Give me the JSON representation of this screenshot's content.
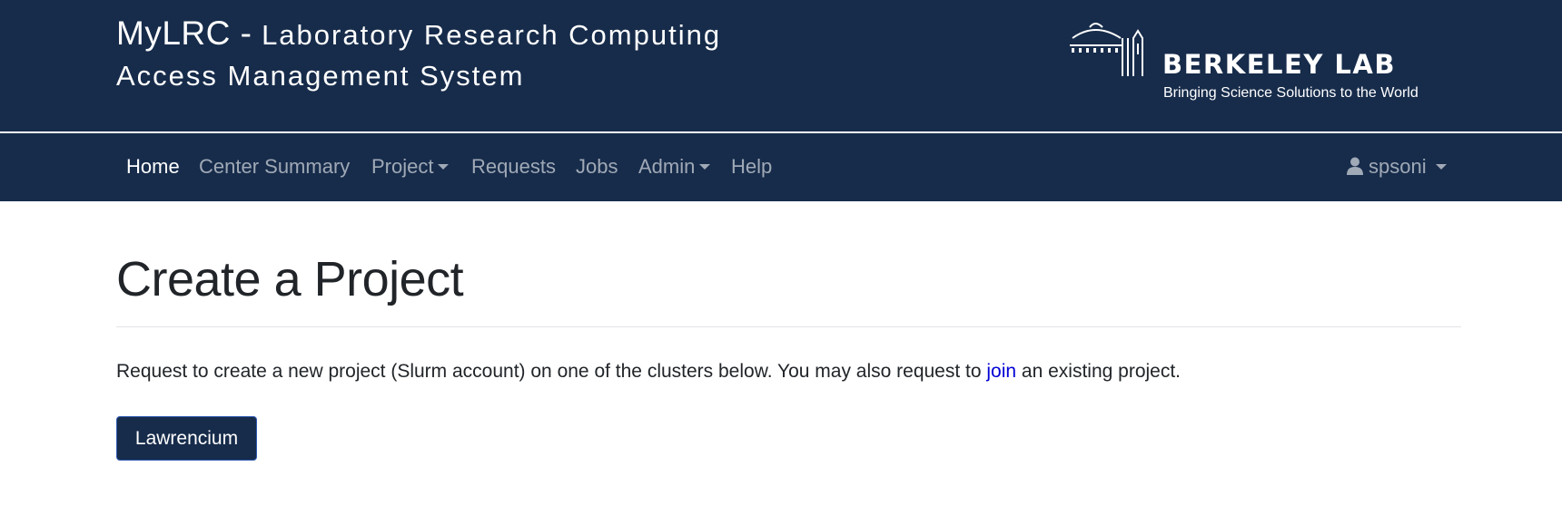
{
  "header": {
    "brand_name": "MyLRC -",
    "brand_line1": " Laboratory Research Computing",
    "brand_line2": "Access Management System",
    "logo_name": "BERKELEY LAB",
    "logo_tagline": "Bringing Science Solutions to the World"
  },
  "nav": {
    "items": [
      {
        "label": "Home",
        "active": true
      },
      {
        "label": "Center Summary"
      },
      {
        "label": "Project",
        "dropdown": true
      },
      {
        "label": "Requests"
      },
      {
        "label": "Jobs"
      },
      {
        "label": "Admin",
        "dropdown": true
      },
      {
        "label": "Help"
      }
    ],
    "user": {
      "label": "spsoni",
      "icon": "user-icon",
      "dropdown": true
    }
  },
  "main": {
    "title": "Create a Project",
    "intro_before": "Request to create a new project (Slurm account) on one of the clusters below. You may also request to ",
    "intro_link": "join",
    "intro_after": " an existing project.",
    "clusters": [
      {
        "label": "Lawrencium"
      }
    ]
  },
  "colors": {
    "header_bg": "#172c4b",
    "nav_text": "#a0a9b6",
    "link": "#0000d4"
  }
}
